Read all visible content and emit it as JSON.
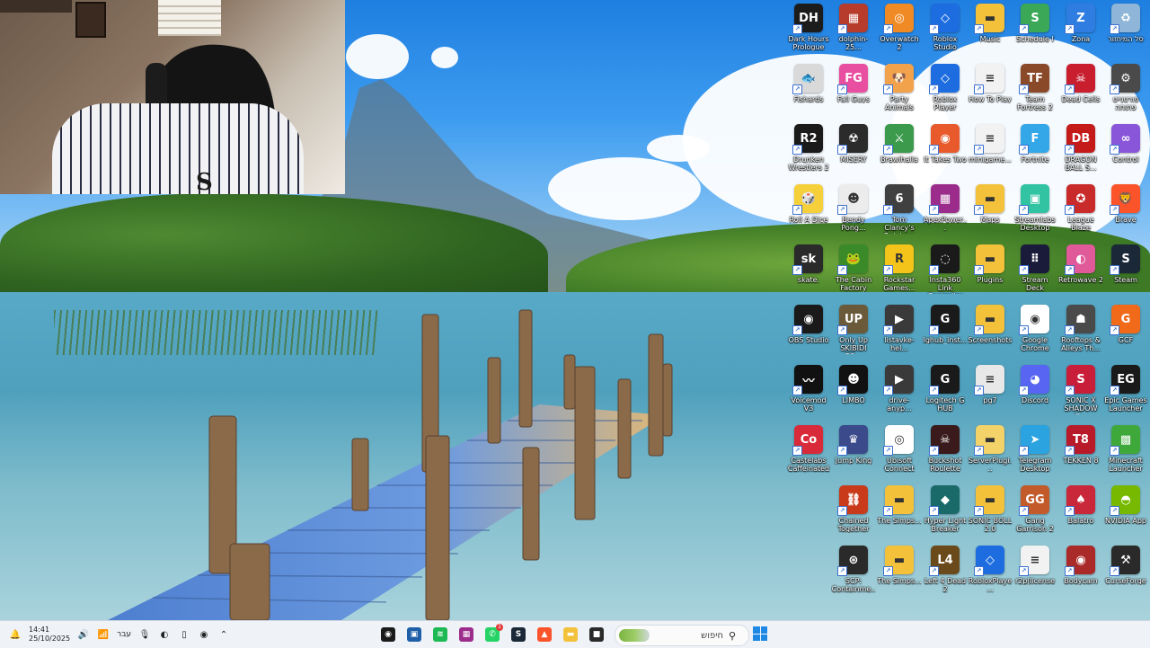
{
  "desktop": {
    "icons": [
      {
        "label": "Dark Hours Prologue",
        "icon": "dark-hours-icon",
        "color": "#1c1c1c",
        "glyph": "DH"
      },
      {
        "label": "dolphin-25...",
        "icon": "dolphin-archive-icon",
        "color": "#b83c2c",
        "glyph": "▦"
      },
      {
        "label": "Overwatch 2",
        "icon": "overwatch-icon",
        "color": "#f08a24",
        "glyph": "◎"
      },
      {
        "label": "Roblox Studio",
        "icon": "roblox-studio-icon",
        "color": "#1e6de0",
        "glyph": "◇"
      },
      {
        "label": "Music",
        "icon": "music-folder-icon",
        "color": "#f3c23a",
        "glyph": "▬"
      },
      {
        "label": "Schedule I",
        "icon": "schedule-one-icon",
        "color": "#3aa857",
        "glyph": "S"
      },
      {
        "label": "Zona",
        "icon": "zona-icon",
        "color": "#2f7de1",
        "glyph": "Z"
      },
      {
        "label": "סל המיחזור",
        "icon": "recycle-bin-icon",
        "color": "#8fb6d8",
        "glyph": "♻"
      },
      {
        "label": "Fishards",
        "icon": "fishards-icon",
        "color": "#d9d9d9",
        "glyph": "🐟"
      },
      {
        "label": "Fall Guys",
        "icon": "fall-guys-icon",
        "color": "#e94fa0",
        "glyph": "FG"
      },
      {
        "label": "Party Animals",
        "icon": "party-animals-icon",
        "color": "#f2a24a",
        "glyph": "🐶"
      },
      {
        "label": "Roblox Player",
        "icon": "roblox-player-icon",
        "color": "#1e6de0",
        "glyph": "◇"
      },
      {
        "label": "How To Play",
        "icon": "text-file-icon",
        "color": "#f2f2f2",
        "glyph": "≡"
      },
      {
        "label": "Team Fortress 2",
        "icon": "tf2-icon",
        "color": "#8a4a2a",
        "glyph": "TF"
      },
      {
        "label": "Dead Cells",
        "icon": "dead-cells-icon",
        "color": "#c81e2e",
        "glyph": "☠"
      },
      {
        "label": "פורטנייט פתוחה",
        "icon": "epic-shortcut-icon",
        "color": "#4a4a4a",
        "glyph": "⚙"
      },
      {
        "label": "Drunken Wrestlers 2",
        "icon": "drunken-wrestlers-icon",
        "color": "#1a1a1a",
        "glyph": "R2"
      },
      {
        "label": "MISERY",
        "icon": "misery-icon",
        "color": "#2b2b2b",
        "glyph": "☢"
      },
      {
        "label": "Brawlhalla",
        "icon": "brawlhalla-icon",
        "color": "#3b9a4c",
        "glyph": "⚔"
      },
      {
        "label": "It Takes Two",
        "icon": "it-takes-two-icon",
        "color": "#e85a2c",
        "glyph": "◉"
      },
      {
        "label": "minigame...",
        "icon": "text-file-icon",
        "color": "#f2f2f2",
        "glyph": "≡"
      },
      {
        "label": "Fortnite",
        "icon": "fortnite-icon",
        "color": "#33a7e8",
        "glyph": "F"
      },
      {
        "label": "DRAGON BALL S...",
        "icon": "dragon-ball-icon",
        "color": "#c41a1a",
        "glyph": "DB"
      },
      {
        "label": "Control",
        "icon": "control-icon",
        "color": "#8a56d9",
        "glyph": "∞"
      },
      {
        "label": "Roll A Dice",
        "icon": "roll-a-dice-icon",
        "color": "#f5d03a",
        "glyph": "🎲"
      },
      {
        "label": "Bendy Pong...",
        "icon": "bendy-icon",
        "color": "#ececec",
        "glyph": "☻"
      },
      {
        "label": "Tom Clancy's Rainbow Six...",
        "icon": "rainbow-six-icon",
        "color": "#404040",
        "glyph": "6"
      },
      {
        "label": "ApexPower...",
        "icon": "winrar-icon",
        "color": "#9c2c8c",
        "glyph": "▦"
      },
      {
        "label": "Maps",
        "icon": "maps-folder-icon",
        "color": "#f3c23a",
        "glyph": "▬"
      },
      {
        "label": "Streamlabs Desktop",
        "icon": "streamlabs-icon",
        "color": "#31c3a2",
        "glyph": "▣"
      },
      {
        "label": "League Blaze",
        "icon": "league-blaze-icon",
        "color": "#c92a2a",
        "glyph": "✪"
      },
      {
        "label": "Brave",
        "icon": "brave-icon",
        "color": "#fb542b",
        "glyph": "🦁"
      },
      {
        "label": "skate.",
        "icon": "skate-icon",
        "color": "#2a2a2a",
        "glyph": "sk"
      },
      {
        "label": "The Cabin Factory",
        "icon": "cabin-factory-icon",
        "color": "#3a8a2a",
        "glyph": "🐸"
      },
      {
        "label": "Rockstar Games...",
        "icon": "rockstar-icon",
        "color": "#f4c41a",
        "glyph": "R"
      },
      {
        "label": "Insta360 Link Controller",
        "icon": "insta360-icon",
        "color": "#1a1a1a",
        "glyph": "◌"
      },
      {
        "label": "Plugins",
        "icon": "plugins-folder-icon",
        "color": "#f3c23a",
        "glyph": "▬"
      },
      {
        "label": "Stream Deck",
        "icon": "stream-deck-icon",
        "color": "#1a1a3a",
        "glyph": "⠿"
      },
      {
        "label": "Retrowave 2",
        "icon": "retrowave-icon",
        "color": "#e05a9a",
        "glyph": "◐"
      },
      {
        "label": "Steam",
        "icon": "steam-icon",
        "color": "#1b2838",
        "glyph": "S"
      },
      {
        "label": "OBS Studio",
        "icon": "obs-studio-icon",
        "color": "#1a1a1a",
        "glyph": "◉"
      },
      {
        "label": "Only Up SKIBIDI TO...",
        "icon": "only-up-icon",
        "color": "#6a5a3a",
        "glyph": "UP"
      },
      {
        "label": "listavke-hel...",
        "icon": "video-file-icon",
        "color": "#3a3a3a",
        "glyph": "▶"
      },
      {
        "label": "lghub_inst...",
        "icon": "logitech-installer-icon",
        "color": "#1a1a1a",
        "glyph": "G"
      },
      {
        "label": "Screenshots",
        "icon": "screenshots-folder-icon",
        "color": "#f3c23a",
        "glyph": "▬"
      },
      {
        "label": "Google Chrome",
        "icon": "chrome-icon",
        "color": "#ffffff",
        "glyph": "◉"
      },
      {
        "label": "Rooftops & Alleys Th...",
        "icon": "rooftops-icon",
        "color": "#4a4a4a",
        "glyph": "☗"
      },
      {
        "label": "GCF",
        "icon": "gcf-icon",
        "color": "#f06a1a",
        "glyph": "G"
      },
      {
        "label": "Voicemod V3",
        "icon": "voicemod-icon",
        "color": "#111111",
        "glyph": "〰"
      },
      {
        "label": "LIMBO",
        "icon": "limbo-icon",
        "color": "#111111",
        "glyph": "☻"
      },
      {
        "label": "drive-anyp...",
        "icon": "video-file-icon",
        "color": "#3a3a3a",
        "glyph": "▶"
      },
      {
        "label": "Logitech G HUB",
        "icon": "logitech-ghub-icon",
        "color": "#1a1a1a",
        "glyph": "G"
      },
      {
        "label": "pg7",
        "icon": "text-file-icon",
        "color": "#e8e8e8",
        "glyph": "≡"
      },
      {
        "label": "Discord",
        "icon": "discord-icon",
        "color": "#5865f2",
        "glyph": "◕"
      },
      {
        "label": "SONIC X SHADOW G...",
        "icon": "sonic-shadow-icon",
        "color": "#c81e3a",
        "glyph": "S"
      },
      {
        "label": "Epic Games Launcher",
        "icon": "epic-games-icon",
        "color": "#1a1a1a",
        "glyph": "EG"
      },
      {
        "label": "Castelabs Caffeinated",
        "icon": "caffeinated-icon",
        "color": "#d92a3a",
        "glyph": "Co"
      },
      {
        "label": "Jump King",
        "icon": "jump-king-icon",
        "color": "#3a4a8a",
        "glyph": "♛"
      },
      {
        "label": "Ubisoft Connect",
        "icon": "ubisoft-icon",
        "color": "#ffffff",
        "glyph": "◎"
      },
      {
        "label": "Buckshot Roulette",
        "icon": "buckshot-icon",
        "color": "#3a1a1a",
        "glyph": "☠"
      },
      {
        "label": "ServerPlugi...",
        "icon": "server-plugins-folder-icon",
        "color": "#f3d26a",
        "glyph": "▬"
      },
      {
        "label": "Telegram Desktop",
        "icon": "telegram-icon",
        "color": "#2aa3e0",
        "glyph": "➤"
      },
      {
        "label": "TEKKEN 8",
        "icon": "tekken-icon",
        "color": "#b81a2a",
        "glyph": "T8"
      },
      {
        "label": "Minecraft Launcher",
        "icon": "minecraft-icon",
        "color": "#3fa83a",
        "glyph": "▩"
      },
      {
        "label": "Chained Together",
        "icon": "chained-together-icon",
        "color": "#c83a1a",
        "glyph": "⛓"
      },
      {
        "label": "The Simps...",
        "icon": "simps-folder-icon",
        "color": "#f3c23a",
        "glyph": "▬"
      },
      {
        "label": "Hyper Light Breaker",
        "icon": "hyper-light-icon",
        "color": "#1a6a6a",
        "glyph": "◆"
      },
      {
        "label": "SONIC BOLL 2.0",
        "icon": "sonic-boll-folder-icon",
        "color": "#f3c23a",
        "glyph": "▬"
      },
      {
        "label": "Gang Garrison 2",
        "icon": "gang-garrison-icon",
        "color": "#c25a2a",
        "glyph": "GG"
      },
      {
        "label": "Balatro",
        "icon": "balatro-icon",
        "color": "#c8283a",
        "glyph": "♠"
      },
      {
        "label": "NVIDIA App",
        "icon": "nvidia-icon",
        "color": "#76b900",
        "glyph": "◓"
      },
      {
        "label": "SCP: Containme...",
        "icon": "scp-icon",
        "color": "#2a2a2a",
        "glyph": "⊛"
      },
      {
        "label": "The Simps...",
        "icon": "simps-folder-icon",
        "color": "#f3c23a",
        "glyph": "▬"
      },
      {
        "label": "Left 4 Dead 2",
        "icon": "left4dead-icon",
        "color": "#6a4a1a",
        "glyph": "L4"
      },
      {
        "label": "RobloxPlaye...",
        "icon": "roblox-player-icon",
        "color": "#1e6de0",
        "glyph": "◇"
      },
      {
        "label": "r2p|license",
        "icon": "text-file-icon",
        "color": "#f2f2f2",
        "glyph": "≡"
      },
      {
        "label": "Bodycam",
        "icon": "bodycam-icon",
        "color": "#aa2a2a",
        "glyph": "◉"
      },
      {
        "label": "CurseForge",
        "icon": "curseforge-icon",
        "color": "#2a2a2a",
        "glyph": "⚒"
      }
    ]
  },
  "taskbar": {
    "clock_time": "14:41",
    "clock_date": "25/10/2025",
    "language": "עבר",
    "search_placeholder": "חיפוש",
    "apps": [
      {
        "name": "obs-taskbar",
        "color": "#1a1a1a",
        "glyph": "◉",
        "badge": ""
      },
      {
        "name": "terminal-taskbar",
        "color": "#1e5fa8",
        "glyph": "▣",
        "badge": ""
      },
      {
        "name": "spotify-taskbar",
        "color": "#1db954",
        "glyph": "≋",
        "badge": ""
      },
      {
        "name": "winrar-taskbar",
        "color": "#9c2c8c",
        "glyph": "▦",
        "badge": ""
      },
      {
        "name": "whatsapp-taskbar",
        "color": "#25d366",
        "glyph": "✆",
        "badge": "1"
      },
      {
        "name": "steam-taskbar",
        "color": "#1b2838",
        "glyph": "S",
        "badge": ""
      },
      {
        "name": "brave-taskbar",
        "color": "#fb542b",
        "glyph": "▲",
        "badge": ""
      },
      {
        "name": "explorer-taskbar",
        "color": "#f3c23a",
        "glyph": "▬",
        "badge": ""
      },
      {
        "name": "app-taskbar",
        "color": "#2a2a2a",
        "glyph": "■",
        "badge": ""
      }
    ]
  }
}
